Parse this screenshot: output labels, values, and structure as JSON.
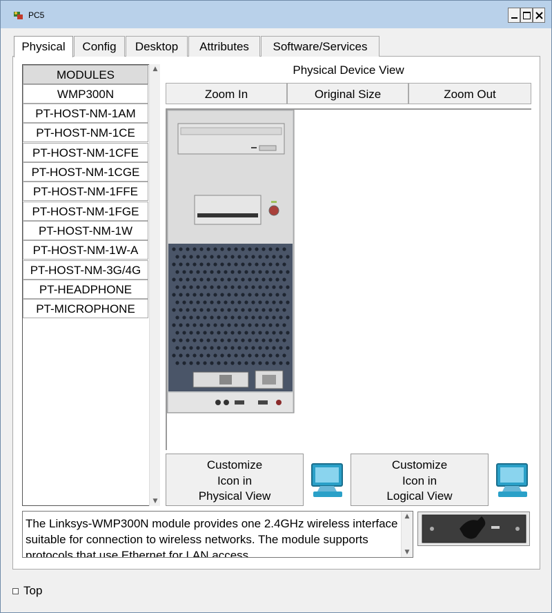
{
  "window": {
    "title": "PC5"
  },
  "tabs": [
    {
      "label": "Physical",
      "active": true
    },
    {
      "label": "Config"
    },
    {
      "label": "Desktop"
    },
    {
      "label": "Attributes"
    },
    {
      "label": "Software/Services"
    }
  ],
  "modules": {
    "header": "MODULES",
    "items": [
      "WMP300N",
      "PT-HOST-NM-1AM",
      "PT-HOST-NM-1CE",
      "PT-HOST-NM-1CFE",
      "PT-HOST-NM-1CGE",
      "PT-HOST-NM-1FFE",
      "PT-HOST-NM-1FGE",
      "PT-HOST-NM-1W",
      "PT-HOST-NM-1W-A",
      "PT-HOST-NM-3G/4G",
      "PT-HEADPHONE",
      "PT-MICROPHONE"
    ]
  },
  "device_view": {
    "title": "Physical Device View",
    "zoom_in": "Zoom In",
    "original_size": "Original Size",
    "zoom_out": "Zoom Out"
  },
  "customize": {
    "physical": {
      "line1": "Customize",
      "line2": "Icon in",
      "line3": "Physical View"
    },
    "logical": {
      "line1": "Customize",
      "line2": "Icon in",
      "line3": "Logical View"
    }
  },
  "description": "The Linksys-WMP300N module provides one 2.4GHz wireless interface suitable for connection to wireless networks. The module supports protocols that use Ethernet for LAN access.",
  "footer": {
    "top_label": "Top"
  }
}
